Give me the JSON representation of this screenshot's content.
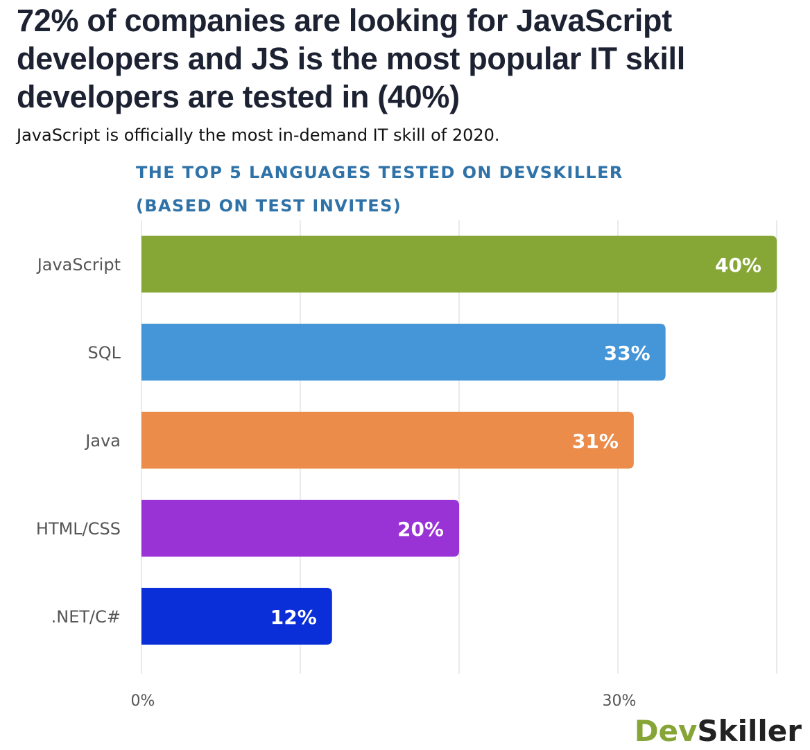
{
  "headline": "72% of companies are looking for JavaScript developers and JS is the most popular IT skill developers are tested in (40%)",
  "subheadline": "JavaScript is officially the most in-demand IT skill of 2020.",
  "logo": {
    "part1": "Dev",
    "part2": "Skiller"
  },
  "chart_data": {
    "type": "bar",
    "orientation": "horizontal",
    "title_lines": [
      "THE TOP 5 LANGUAGES TESTED ON DEVSKILLER",
      "(BASED ON TEST INVITES)"
    ],
    "categories": [
      "JavaScript",
      "SQL",
      "Java",
      "HTML/CSS",
      ".NET/C#"
    ],
    "values": [
      40,
      33,
      31,
      20,
      12
    ],
    "value_labels": [
      "40%",
      "33%",
      "31%",
      "20%",
      "12%"
    ],
    "colors": [
      "#86a736",
      "#4496d8",
      "#eb8c4b",
      "#9933d6",
      "#0a2ed8"
    ],
    "xlim": [
      0,
      40
    ],
    "xticks": [
      0,
      30
    ],
    "xtick_labels": [
      "0%",
      "30%"
    ],
    "grid": true
  }
}
